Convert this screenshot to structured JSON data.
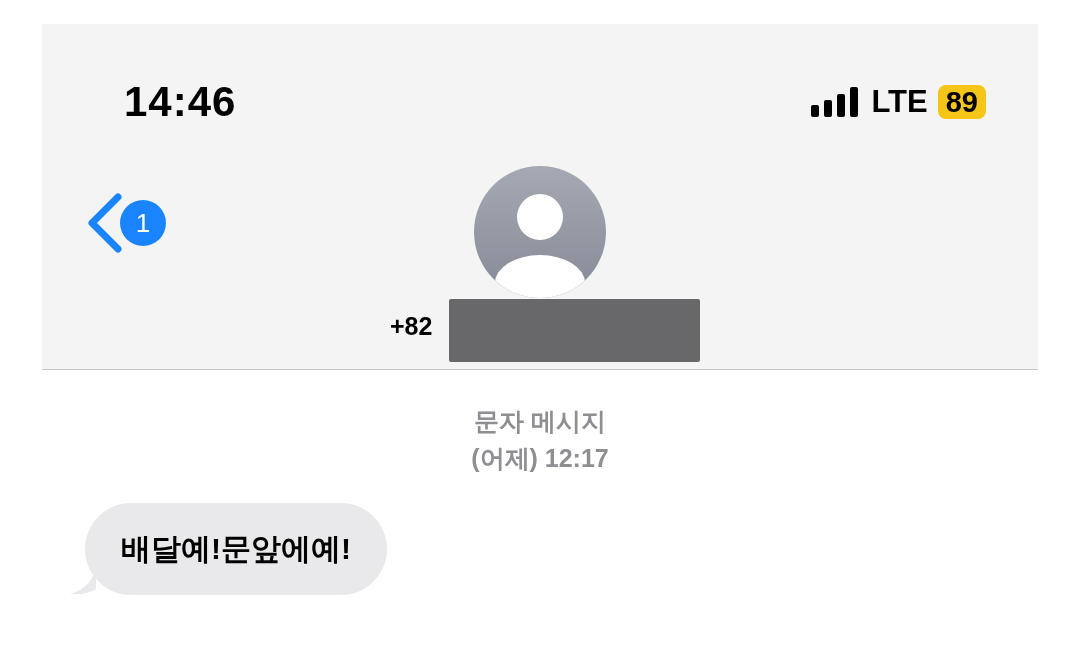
{
  "status_bar": {
    "time": "14:46",
    "network": "LTE",
    "battery": "89"
  },
  "nav": {
    "back_badge": "1",
    "contact_prefix": "+82"
  },
  "thread": {
    "service": "문자 메시지",
    "timestamp": "(어제) 12:17",
    "messages": [
      {
        "text": "배달예!문앞에예!",
        "kind": "incoming"
      }
    ]
  }
}
